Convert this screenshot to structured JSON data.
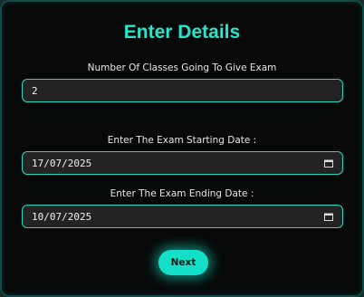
{
  "form": {
    "title": "Enter Details",
    "classes": {
      "label": "Number Of Classes Going To Give Exam",
      "value": "2"
    },
    "start_date": {
      "label": "Enter The Exam Starting Date :",
      "value": "17/07/2025",
      "icon": "calendar-icon"
    },
    "end_date": {
      "label": "Enter The Exam Ending Date :",
      "value": "10/07/2025",
      "icon": "calendar-icon"
    },
    "next_label": "Next"
  },
  "colors": {
    "accent": "#22e8d0",
    "background": "#070909",
    "field_bg": "#232323",
    "button": "#14e0c8"
  }
}
